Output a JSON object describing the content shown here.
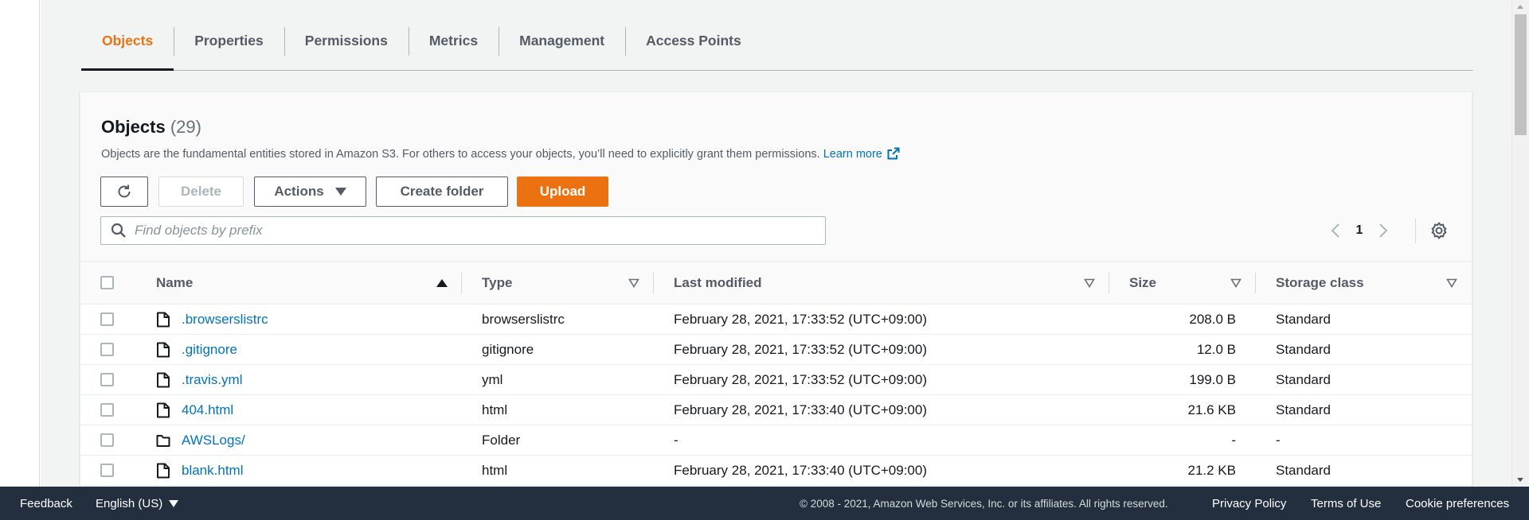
{
  "tabs": [
    {
      "label": "Objects",
      "active": true
    },
    {
      "label": "Properties"
    },
    {
      "label": "Permissions"
    },
    {
      "label": "Metrics"
    },
    {
      "label": "Management"
    },
    {
      "label": "Access Points"
    }
  ],
  "panel": {
    "title": "Objects",
    "count": "(29)",
    "description": "Objects are the fundamental entities stored in Amazon S3. For others to access your objects, you’ll need to explicitly grant them permissions.",
    "learn_more": "Learn more"
  },
  "toolbar": {
    "delete_label": "Delete",
    "actions_label": "Actions",
    "create_folder_label": "Create folder",
    "upload_label": "Upload"
  },
  "search": {
    "placeholder": "Find objects by prefix",
    "value": ""
  },
  "pagination": {
    "current_page": "1"
  },
  "table": {
    "columns": [
      "Name",
      "Type",
      "Last modified",
      "Size",
      "Storage class"
    ],
    "rows": [
      {
        "name": ".browserslistrc",
        "kind": "file",
        "type": "browserslistrc",
        "last_modified": "February 28, 2021, 17:33:52 (UTC+09:00)",
        "size": "208.0 B",
        "storage_class": "Standard"
      },
      {
        "name": ".gitignore",
        "kind": "file",
        "type": "gitignore",
        "last_modified": "February 28, 2021, 17:33:52 (UTC+09:00)",
        "size": "12.0 B",
        "storage_class": "Standard"
      },
      {
        "name": ".travis.yml",
        "kind": "file",
        "type": "yml",
        "last_modified": "February 28, 2021, 17:33:52 (UTC+09:00)",
        "size": "199.0 B",
        "storage_class": "Standard"
      },
      {
        "name": "404.html",
        "kind": "file",
        "type": "html",
        "last_modified": "February 28, 2021, 17:33:40 (UTC+09:00)",
        "size": "21.6 KB",
        "storage_class": "Standard"
      },
      {
        "name": "AWSLogs/",
        "kind": "folder",
        "type": "Folder",
        "last_modified": "-",
        "size": "-",
        "storage_class": "-"
      },
      {
        "name": "blank.html",
        "kind": "file",
        "type": "html",
        "last_modified": "February 28, 2021, 17:33:40 (UTC+09:00)",
        "size": "21.2 KB",
        "storage_class": "Standard"
      }
    ]
  },
  "footer": {
    "feedback": "Feedback",
    "language": "English (US)",
    "copyright": "© 2008 - 2021, Amazon Web Services, Inc. or its affiliates. All rights reserved.",
    "privacy": "Privacy Policy",
    "terms": "Terms of Use",
    "cookies": "Cookie preferences"
  },
  "colors": {
    "accent": "#ec7211",
    "link": "#0073bb",
    "footer_bg": "#232f3e"
  }
}
